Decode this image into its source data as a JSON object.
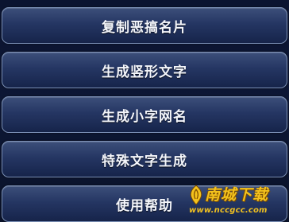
{
  "menu": {
    "items": [
      {
        "label": "复制恶搞名片"
      },
      {
        "label": "生成竖形文字"
      },
      {
        "label": "生成小字网名"
      },
      {
        "label": "特殊文字生成"
      },
      {
        "label": "使用帮助"
      }
    ]
  },
  "watermark": {
    "title": "南城下载",
    "url": "www.nccgcc.com",
    "color": "#f3c21d"
  }
}
